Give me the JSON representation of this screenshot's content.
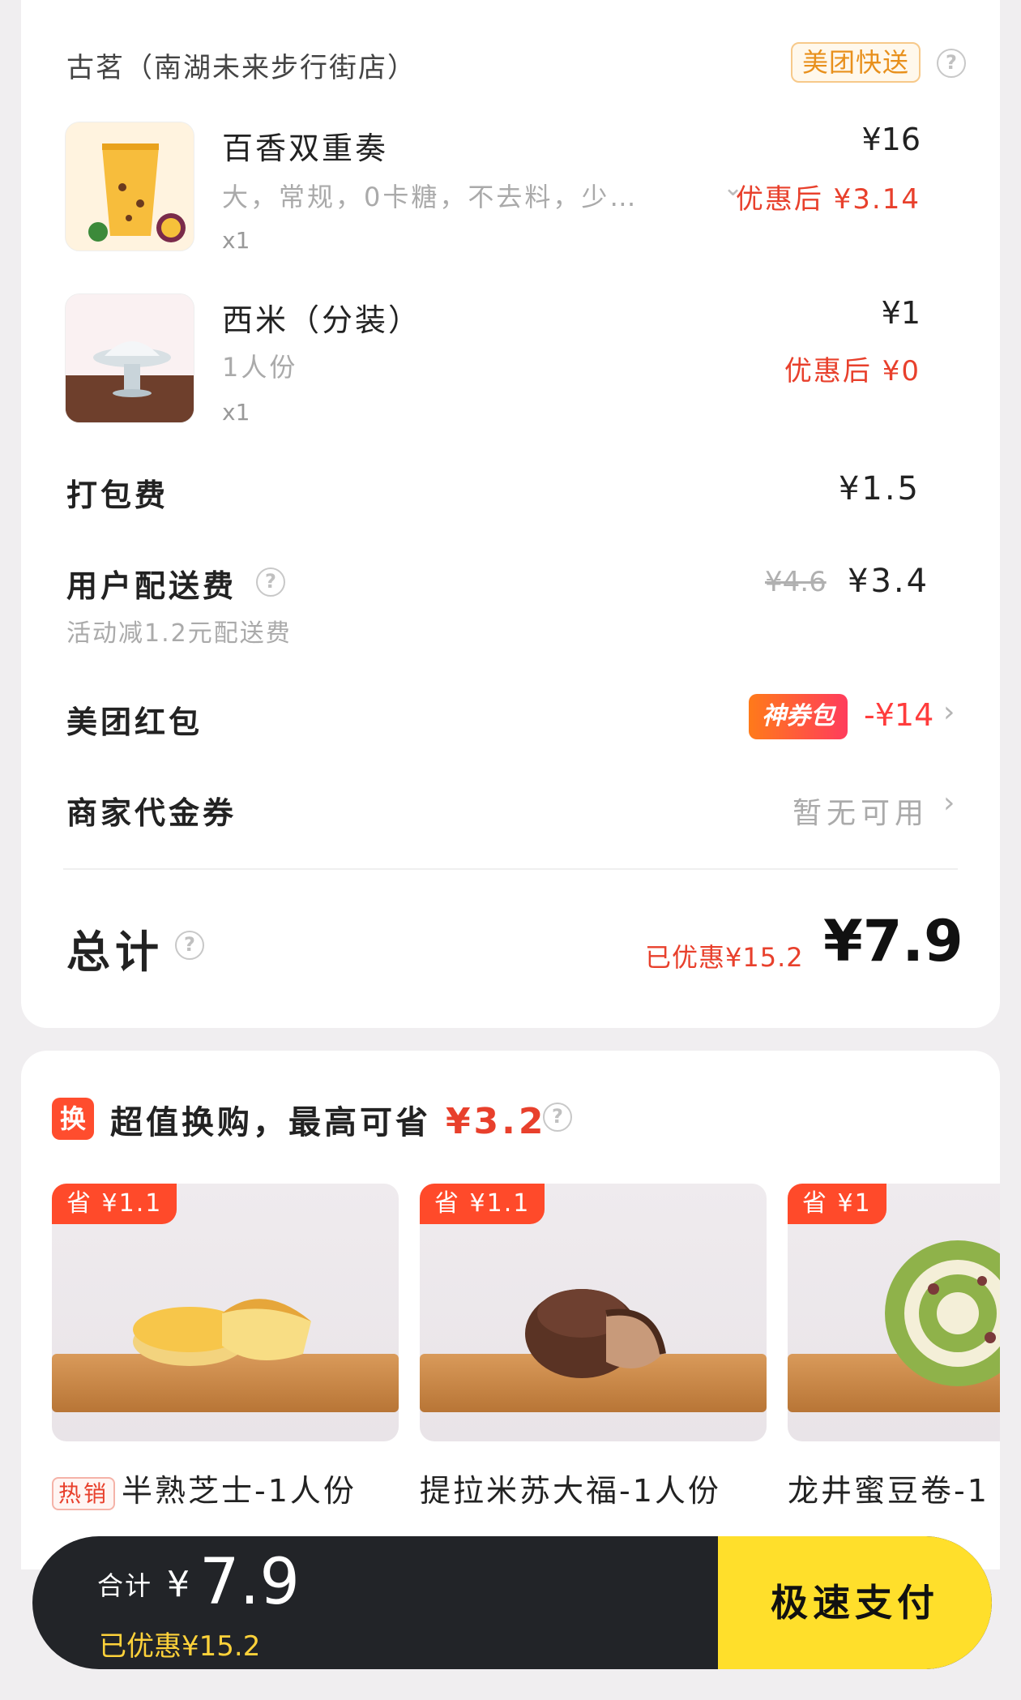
{
  "store": {
    "name": "古茗（南湖未来步行街店）",
    "delivery_badge": "美团快送",
    "help_icon": "question-circle-icon"
  },
  "items": [
    {
      "name": "百香双重奏",
      "spec": "大，常规，0卡糖，不去料，少…",
      "qty": "x1",
      "price": "¥16",
      "discount_price": "优惠后 ¥3.14"
    },
    {
      "name": "西米（分装）",
      "spec": "1人份",
      "qty": "x1",
      "price": "¥1",
      "discount_price": "优惠后 ¥0"
    }
  ],
  "fees": {
    "packing_label": "打包费",
    "packing_value": "¥1.5",
    "delivery_label": "用户配送费",
    "delivery_note": "活动减1.2元配送费",
    "delivery_original": "¥4.6",
    "delivery_value": "¥3.4",
    "redpack_label": "美团红包",
    "redpack_badge": "神券包",
    "redpack_value": "-¥14",
    "voucher_label": "商家代金券",
    "voucher_value": "暂无可用"
  },
  "total": {
    "label": "总计",
    "saved": "已优惠¥15.2",
    "value": "¥7.9"
  },
  "promo": {
    "icon_text": "换",
    "title": "超值换购，最高可省",
    "max_saving": "¥3.2",
    "products": [
      {
        "save_tag": "省 ¥1.1",
        "hot_tag": "热销",
        "name": "半熟芝士-1人份"
      },
      {
        "save_tag": "省 ¥1.1",
        "name": "提拉米苏大福-1人份"
      },
      {
        "save_tag": "省 ¥1",
        "name": "龙井蜜豆卷-1"
      }
    ]
  },
  "checkout": {
    "total_label": "合计",
    "yen": "¥",
    "total_value": "7.9",
    "saved": "已优惠¥15.2",
    "pay_button": "极速支付"
  },
  "colors": {
    "accent_red": "#e8402c",
    "pay_yellow": "#ffdf2b",
    "bar_dark": "#222428"
  }
}
